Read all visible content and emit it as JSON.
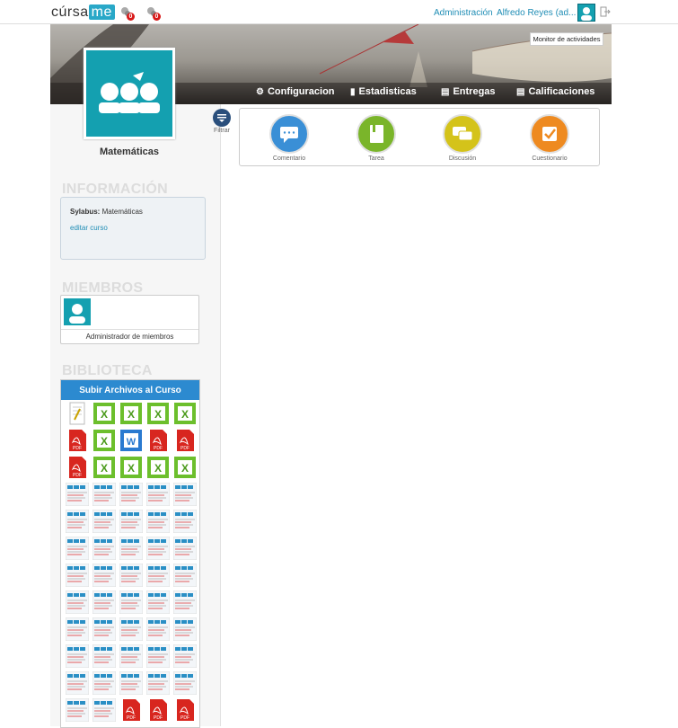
{
  "header": {
    "logo_left": "cúrsa",
    "logo_right": "me",
    "notifications": [
      {
        "icon": "bell-icon",
        "badge": "0"
      },
      {
        "icon": "chat-icon",
        "badge": "0"
      }
    ],
    "admin_label": "Administración",
    "user_label": "Alfredo Reyes (ad...",
    "monitor_label": "Monitor de actividades"
  },
  "nav": {
    "items": [
      {
        "label": "Configuracion",
        "icon": "gear-icon"
      },
      {
        "label": "Estadisticas",
        "icon": "bar-chart-icon"
      },
      {
        "label": "Entregas",
        "icon": "document-icon"
      },
      {
        "label": "Calificaciones",
        "icon": "document-icon"
      }
    ]
  },
  "course": {
    "name": "Matemáticas"
  },
  "filter": {
    "label": "Filtrar"
  },
  "post_options": [
    {
      "label": "Comentario",
      "color": "#3a8fd6",
      "icon": "speech-bubble-icon"
    },
    {
      "label": "Tarea",
      "color": "#7ab52a",
      "icon": "book-icon"
    },
    {
      "label": "Discusión",
      "color": "#d4c31a",
      "icon": "discussion-icon"
    },
    {
      "label": "Cuestionario",
      "color": "#ee8a20",
      "icon": "checkbox-icon"
    }
  ],
  "info": {
    "title": "INFORMACIÓN",
    "syllabus_label": "Sylabus:",
    "syllabus_value": "Matemáticas",
    "edit_link": "editar curso"
  },
  "members": {
    "title": "MIEMBROS",
    "manager_label": "Administrador de miembros"
  },
  "library": {
    "title": "BIBLIOTECA",
    "upload_label": "Subir Archivos al Curso",
    "files": [
      "doc",
      "xls",
      "xls",
      "xls",
      "xls",
      "pdf",
      "xls",
      "word",
      "pdf",
      "pdf",
      "pdf",
      "xls",
      "xls",
      "xls",
      "xls",
      "shot",
      "shot",
      "shot",
      "shot",
      "shot",
      "shot",
      "shot",
      "shot",
      "shot",
      "shot",
      "shot",
      "shot",
      "shot",
      "shot",
      "shot",
      "shot",
      "shot",
      "shot",
      "shot",
      "shot",
      "shot",
      "shot",
      "shot",
      "shot",
      "shot",
      "shot",
      "shot",
      "shot",
      "shot",
      "shot",
      "shot",
      "shot",
      "shot",
      "shot",
      "shot",
      "shot",
      "shot",
      "shot",
      "shot",
      "shot",
      "shot",
      "shot",
      "pdf",
      "pdf",
      "pdf"
    ]
  },
  "colors": {
    "accent": "#14a0b0",
    "link": "#1f8db5",
    "library_header": "#2c8ad0"
  }
}
